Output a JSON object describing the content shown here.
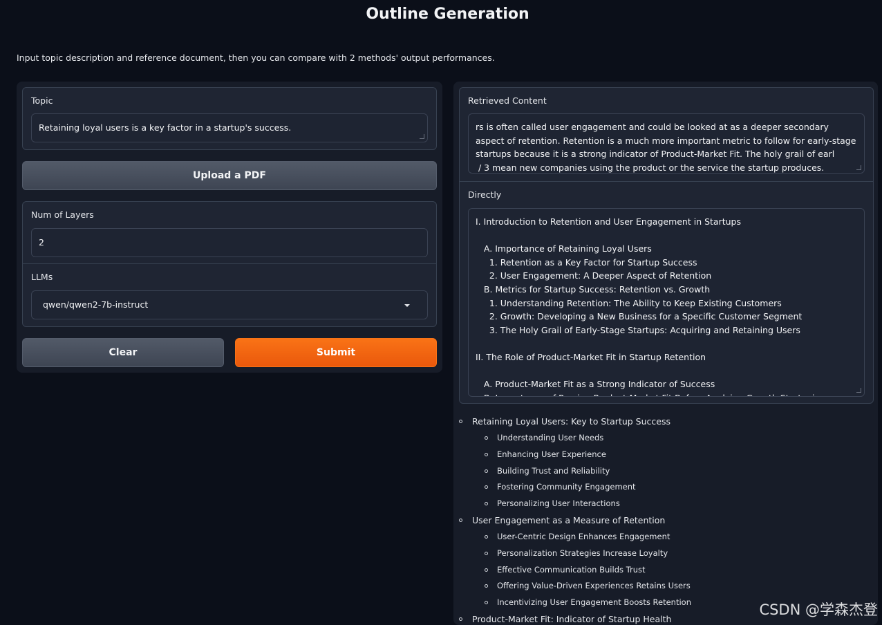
{
  "page": {
    "title": "Outline Generation",
    "description": "Input topic description and reference document, then you can compare with 2 methods' output performances."
  },
  "left": {
    "topic_label": "Topic",
    "topic_value": "Retaining loyal users is a key factor in a startup's success.",
    "upload_label": "Upload a PDF",
    "layers_label": "Num of Layers",
    "layers_value": "2",
    "llms_label": "LLMs",
    "llms_value": "qwen/qwen2-7b-instruct",
    "clear_label": "Clear",
    "submit_label": "Submit"
  },
  "right": {
    "retrieved_label": "Retrieved Content",
    "retrieved_text": "rs is often called user engagement and could be looked at as a deeper secondary aspect of retention. Retention is a much more important metric to follow for early-stage startups because it is a strong indicator of Product-Market Fit. The holy grail of earl\n / 3 mean new companies using the product or the service the startup produces. Growth is a",
    "directly_label": "Directly",
    "directly_text": "I. Introduction to Retention and User Engagement in Startups\n\n   A. Importance of Retaining Loyal Users\n     1. Retention as a Key Factor for Startup Success\n     2. User Engagement: A Deeper Aspect of Retention\n   B. Metrics for Startup Success: Retention vs. Growth\n     1. Understanding Retention: The Ability to Keep Existing Customers\n     2. Growth: Developing a New Business for a Specific Customer Segment\n     3. The Holy Grail of Early-Stage Startups: Acquiring and Retaining Users\n\nII. The Role of Product-Market Fit in Startup Retention\n\n   A. Product-Market Fit as a Strong Indicator of Success\n   B. Importance of Proving Product-Market Fit Before Applying Growth Strategies",
    "outline": [
      {
        "title": "Retaining Loyal Users: Key to Startup Success",
        "children": [
          "Understanding User Needs",
          "Enhancing User Experience",
          "Building Trust and Reliability",
          "Fostering Community Engagement",
          "Personalizing User Interactions"
        ]
      },
      {
        "title": "User Engagement as a Measure of Retention",
        "children": [
          "User-Centric Design Enhances Engagement",
          "Personalization Strategies Increase Loyalty",
          "Effective Communication Builds Trust",
          "Offering Value-Driven Experiences Retains Users",
          "Incentivizing User Engagement Boosts Retention"
        ]
      },
      {
        "title": "Product-Market Fit: Indicator of Startup Health",
        "children": []
      }
    ]
  },
  "watermark": "CSDN @学森杰登"
}
